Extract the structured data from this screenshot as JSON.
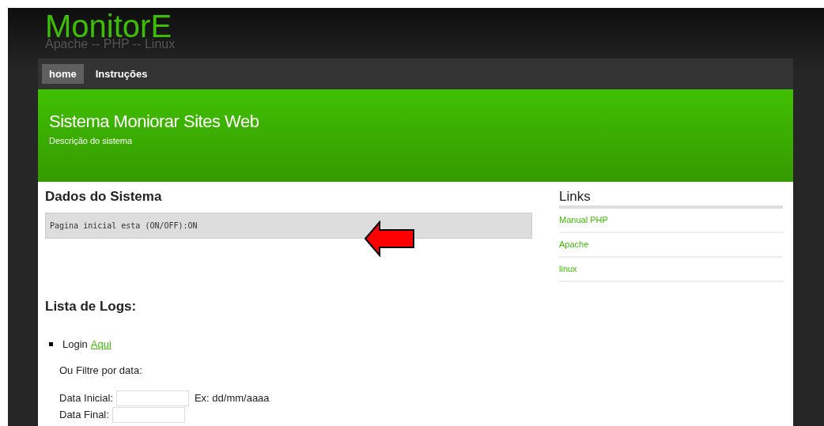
{
  "header": {
    "logo": "MonitorE",
    "tagline": "Apache -- PHP -- Linux"
  },
  "nav": [
    {
      "label": "home",
      "selected": true
    },
    {
      "label": "Instruções",
      "selected": false
    }
  ],
  "banner": {
    "title": "Sistema Moniorar Sites Web",
    "subtitle": "Descrição do sistema"
  },
  "main": {
    "heading": "Dados do Sistema",
    "status_text": "Pagina inicial esta (ON/OFF):ON",
    "logs_heading": "Lista de Logs:",
    "log_items": [
      {
        "label": "Login",
        "link": "Aqui"
      }
    ],
    "filter_label": "Ou Filtre por data:",
    "fields": [
      {
        "label": "Data Inicial:",
        "hint": "Ex: dd/mm/aaaa"
      },
      {
        "label": "Data Final:"
      }
    ]
  },
  "sidebar": {
    "heading": "Links",
    "links": [
      "Manual PHP",
      "Apache",
      "linux"
    ]
  }
}
